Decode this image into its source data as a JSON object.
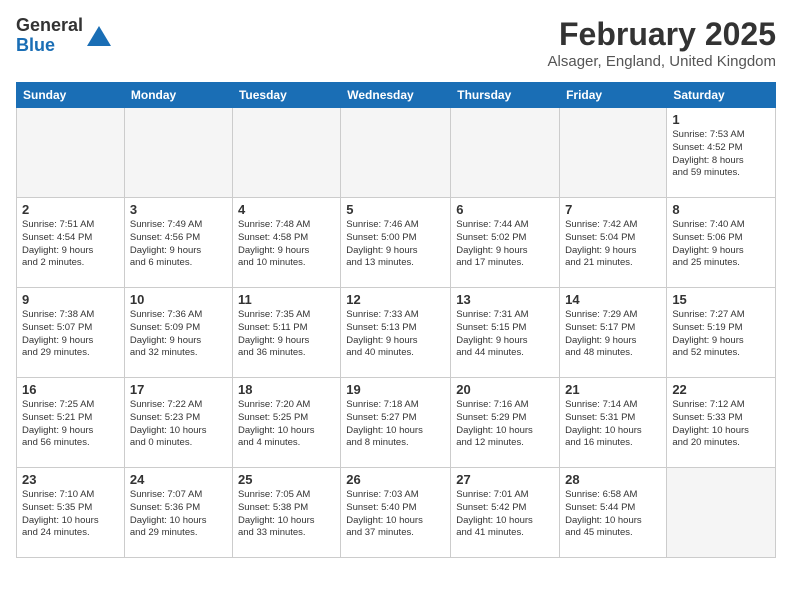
{
  "header": {
    "logo_general": "General",
    "logo_blue": "Blue",
    "month_title": "February 2025",
    "location": "Alsager, England, United Kingdom"
  },
  "weekdays": [
    "Sunday",
    "Monday",
    "Tuesday",
    "Wednesday",
    "Thursday",
    "Friday",
    "Saturday"
  ],
  "weeks": [
    [
      {
        "day": "",
        "info": ""
      },
      {
        "day": "",
        "info": ""
      },
      {
        "day": "",
        "info": ""
      },
      {
        "day": "",
        "info": ""
      },
      {
        "day": "",
        "info": ""
      },
      {
        "day": "",
        "info": ""
      },
      {
        "day": "1",
        "info": "Sunrise: 7:53 AM\nSunset: 4:52 PM\nDaylight: 8 hours\nand 59 minutes."
      }
    ],
    [
      {
        "day": "2",
        "info": "Sunrise: 7:51 AM\nSunset: 4:54 PM\nDaylight: 9 hours\nand 2 minutes."
      },
      {
        "day": "3",
        "info": "Sunrise: 7:49 AM\nSunset: 4:56 PM\nDaylight: 9 hours\nand 6 minutes."
      },
      {
        "day": "4",
        "info": "Sunrise: 7:48 AM\nSunset: 4:58 PM\nDaylight: 9 hours\nand 10 minutes."
      },
      {
        "day": "5",
        "info": "Sunrise: 7:46 AM\nSunset: 5:00 PM\nDaylight: 9 hours\nand 13 minutes."
      },
      {
        "day": "6",
        "info": "Sunrise: 7:44 AM\nSunset: 5:02 PM\nDaylight: 9 hours\nand 17 minutes."
      },
      {
        "day": "7",
        "info": "Sunrise: 7:42 AM\nSunset: 5:04 PM\nDaylight: 9 hours\nand 21 minutes."
      },
      {
        "day": "8",
        "info": "Sunrise: 7:40 AM\nSunset: 5:06 PM\nDaylight: 9 hours\nand 25 minutes."
      }
    ],
    [
      {
        "day": "9",
        "info": "Sunrise: 7:38 AM\nSunset: 5:07 PM\nDaylight: 9 hours\nand 29 minutes."
      },
      {
        "day": "10",
        "info": "Sunrise: 7:36 AM\nSunset: 5:09 PM\nDaylight: 9 hours\nand 32 minutes."
      },
      {
        "day": "11",
        "info": "Sunrise: 7:35 AM\nSunset: 5:11 PM\nDaylight: 9 hours\nand 36 minutes."
      },
      {
        "day": "12",
        "info": "Sunrise: 7:33 AM\nSunset: 5:13 PM\nDaylight: 9 hours\nand 40 minutes."
      },
      {
        "day": "13",
        "info": "Sunrise: 7:31 AM\nSunset: 5:15 PM\nDaylight: 9 hours\nand 44 minutes."
      },
      {
        "day": "14",
        "info": "Sunrise: 7:29 AM\nSunset: 5:17 PM\nDaylight: 9 hours\nand 48 minutes."
      },
      {
        "day": "15",
        "info": "Sunrise: 7:27 AM\nSunset: 5:19 PM\nDaylight: 9 hours\nand 52 minutes."
      }
    ],
    [
      {
        "day": "16",
        "info": "Sunrise: 7:25 AM\nSunset: 5:21 PM\nDaylight: 9 hours\nand 56 minutes."
      },
      {
        "day": "17",
        "info": "Sunrise: 7:22 AM\nSunset: 5:23 PM\nDaylight: 10 hours\nand 0 minutes."
      },
      {
        "day": "18",
        "info": "Sunrise: 7:20 AM\nSunset: 5:25 PM\nDaylight: 10 hours\nand 4 minutes."
      },
      {
        "day": "19",
        "info": "Sunrise: 7:18 AM\nSunset: 5:27 PM\nDaylight: 10 hours\nand 8 minutes."
      },
      {
        "day": "20",
        "info": "Sunrise: 7:16 AM\nSunset: 5:29 PM\nDaylight: 10 hours\nand 12 minutes."
      },
      {
        "day": "21",
        "info": "Sunrise: 7:14 AM\nSunset: 5:31 PM\nDaylight: 10 hours\nand 16 minutes."
      },
      {
        "day": "22",
        "info": "Sunrise: 7:12 AM\nSunset: 5:33 PM\nDaylight: 10 hours\nand 20 minutes."
      }
    ],
    [
      {
        "day": "23",
        "info": "Sunrise: 7:10 AM\nSunset: 5:35 PM\nDaylight: 10 hours\nand 24 minutes."
      },
      {
        "day": "24",
        "info": "Sunrise: 7:07 AM\nSunset: 5:36 PM\nDaylight: 10 hours\nand 29 minutes."
      },
      {
        "day": "25",
        "info": "Sunrise: 7:05 AM\nSunset: 5:38 PM\nDaylight: 10 hours\nand 33 minutes."
      },
      {
        "day": "26",
        "info": "Sunrise: 7:03 AM\nSunset: 5:40 PM\nDaylight: 10 hours\nand 37 minutes."
      },
      {
        "day": "27",
        "info": "Sunrise: 7:01 AM\nSunset: 5:42 PM\nDaylight: 10 hours\nand 41 minutes."
      },
      {
        "day": "28",
        "info": "Sunrise: 6:58 AM\nSunset: 5:44 PM\nDaylight: 10 hours\nand 45 minutes."
      },
      {
        "day": "",
        "info": ""
      }
    ]
  ]
}
